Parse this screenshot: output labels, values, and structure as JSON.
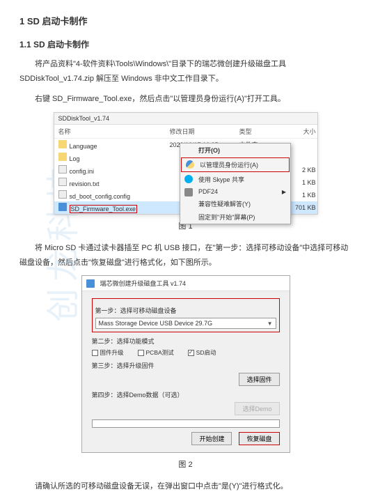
{
  "watermark": "创龙科技",
  "h1": "1 SD 启动卡制作",
  "h2": "1.1  SD 启动卡制作",
  "para1": "将产品资料\"4-软件资料\\Tools\\Windows\\\"目录下的瑞芯微创建升级磁盘工具 SDDiskTool_v1.74.zip 解压至 Windows 非中文工作目录下。",
  "para2": "右键 SD_Firmware_Tool.exe，然后点击\"以管理员身份运行(A)\"打开工具。",
  "explorer": {
    "title": "SDDiskTool_v1.74",
    "headers": {
      "name": "名称",
      "date": "修改日期",
      "type": "类型",
      "size": "大小"
    },
    "rows": [
      {
        "icon": "folder",
        "name": "Language",
        "date": "2023/10/17 16:25",
        "type": "文件夹",
        "size": ""
      },
      {
        "icon": "folder",
        "name": "Log",
        "date": "",
        "type": "",
        "size": ""
      },
      {
        "icon": "doc",
        "name": "config.ini",
        "date": "",
        "type": "",
        "size": "2 KB"
      },
      {
        "icon": "doc",
        "name": "revision.txt",
        "date": "",
        "type": "",
        "size": "1 KB"
      },
      {
        "icon": "doc",
        "name": "sd_boot_config.config",
        "date": "",
        "type": "",
        "size": "1 KB"
      },
      {
        "icon": "exe",
        "name": "SD_Firmware_Tool.exe",
        "date": "",
        "type": "",
        "size": "701 KB",
        "selected": true,
        "highlight": true
      }
    ]
  },
  "contextMenu": {
    "items": [
      {
        "label": "打开(O)",
        "bold": true
      },
      {
        "label": "以管理员身份运行(A)",
        "icon": "shield",
        "highlight": true
      },
      {
        "label": "使用 Skype 共享",
        "icon": "skype"
      },
      {
        "label": "PDF24",
        "icon": "pdf24",
        "arrow": true
      },
      {
        "label": "兼容性疑难解答(Y)"
      },
      {
        "label": "固定到\"开始\"屏幕(P)"
      }
    ]
  },
  "figCaption1": "图  1",
  "para3": "将 Micro SD 卡通过读卡器插至 PC 机 USB 接口，在\"第一步：选择可移动设备\"中选择可移动磁盘设备，然后点击\"恢复磁盘\"进行格式化，如下图所示。",
  "tool": {
    "title": "瑞芯微创建升级磁盘工具 v1.74",
    "step1Label": "第一步：选择可移动磁盘设备",
    "dropdownValue": "Mass Storage Device USB Device    29.7G",
    "step2Label": "第二步：选择功能模式",
    "checkboxes": [
      {
        "label": "固件升级",
        "checked": false
      },
      {
        "label": "PCBA测试",
        "checked": false
      },
      {
        "label": "SD启动",
        "checked": true
      }
    ],
    "step3Label": "第三步：选择升级固件",
    "browseBtn": "选择固件",
    "step4Label": "第四步：选择Demo数据（可选）",
    "demoBtn": "选择Demo",
    "createBtn": "开始创建",
    "restoreBtn": "恢复磁盘"
  },
  "figCaption2": "图  2",
  "para4": "请确认所选的可移动磁盘设备无误，在弹出窗口中点击\"是(Y)\"进行格式化。"
}
